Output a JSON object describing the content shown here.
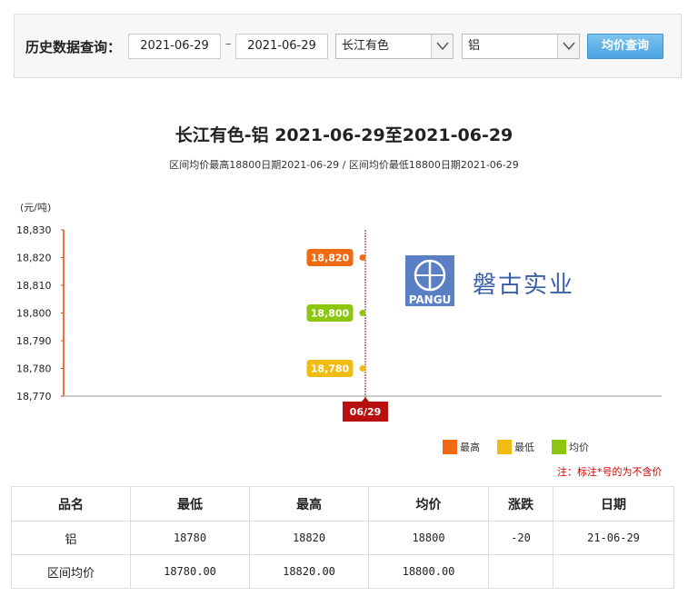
{
  "query": {
    "label": "历史数据查询：",
    "start_date": "2021-06-29",
    "separator": "–",
    "end_date": "2021-06-29",
    "market": "长江有色",
    "metal": "铝",
    "button_label": "均价查询"
  },
  "chart_data": {
    "type": "line",
    "title": "长江有色-铝 2021-06-29至2021-06-29",
    "subtitle": "区间均价最高18800日期2021-06-29 / 区间均价最低18800日期2021-06-29",
    "ylabel": "(元/吨)",
    "ylim": [
      18770,
      18830
    ],
    "yticks": [
      "18,770",
      "18,780",
      "18,790",
      "18,800",
      "18,810",
      "18,820",
      "18,830"
    ],
    "categories": [
      "06/29"
    ],
    "series": [
      {
        "name": "最高",
        "values": [
          18820
        ],
        "label": "18,820",
        "color": "#f06a12"
      },
      {
        "name": "最低",
        "values": [
          18780
        ],
        "label": "18,780",
        "color": "#f0bc12"
      },
      {
        "name": "均价",
        "values": [
          18800
        ],
        "label": "18,800",
        "color": "#8cc611"
      }
    ],
    "legend_position": "bottom-right",
    "grid": false
  },
  "watermark": {
    "logo_text": "PANGU",
    "company": "磐古实业"
  },
  "note": "注：标注*号的为不含价",
  "table": {
    "headers": [
      "品名",
      "最低",
      "最高",
      "均价",
      "涨跌",
      "日期"
    ],
    "rows": [
      [
        "铝",
        "18780",
        "18820",
        "18800",
        "-20",
        "21-06-29"
      ],
      [
        "区间均价",
        "18780.00",
        "18820.00",
        "18800.00",
        "",
        ""
      ]
    ]
  }
}
